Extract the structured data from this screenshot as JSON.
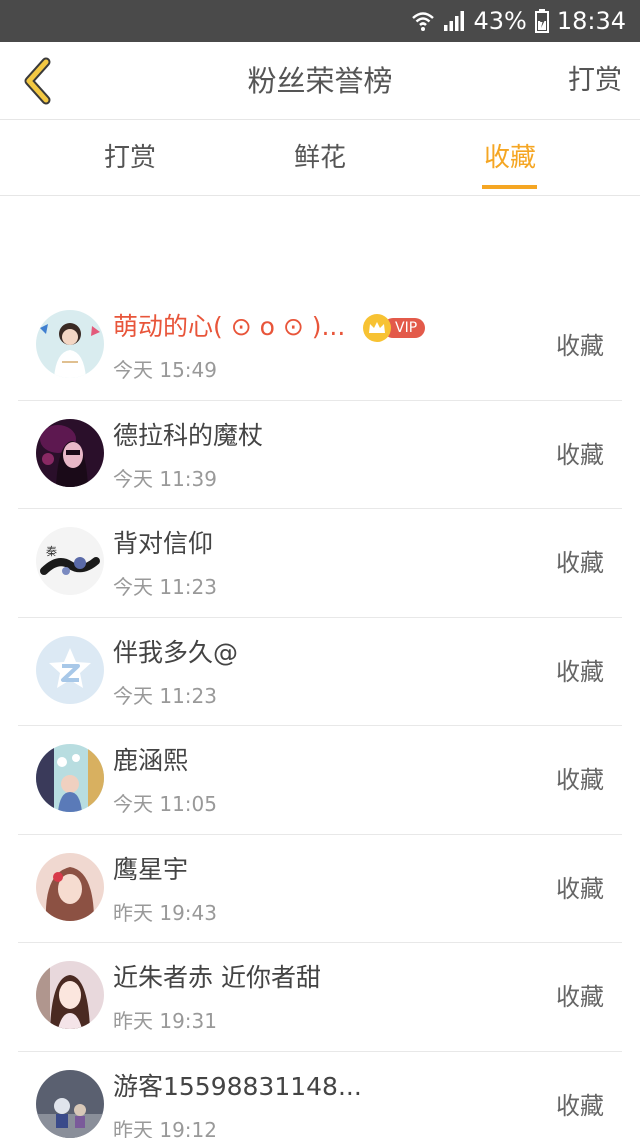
{
  "status_bar": {
    "battery": "43%",
    "time": "18:34",
    "icons": [
      "wifi-icon",
      "signal-icon",
      "battery-icon"
    ]
  },
  "nav": {
    "title": "粉丝荣誉榜",
    "right": "打赏",
    "back_icon": "chevron-left-icon"
  },
  "tabs": [
    {
      "label": "打赏",
      "active": false
    },
    {
      "label": "鲜花",
      "active": false
    },
    {
      "label": "收藏",
      "active": true
    }
  ],
  "colors": {
    "accent": "#f5a623",
    "highlight_name": "#e8553a",
    "vip": "#e35a4a"
  },
  "list": [
    {
      "name": "萌动的心( ⊙ o ⊙ )...",
      "time": "今天 15:49",
      "action": "收藏",
      "vip": "VIP",
      "highlight": true
    },
    {
      "name": "德拉科的魔杖",
      "time": "今天 11:39",
      "action": "收藏"
    },
    {
      "name": "背对信仰",
      "time": "今天 11:23",
      "action": "收藏"
    },
    {
      "name": "伴我多久@",
      "time": "今天 11:23",
      "action": "收藏"
    },
    {
      "name": "鹿涵熙",
      "time": "今天 11:05",
      "action": "收藏"
    },
    {
      "name": "鹰星宇",
      "time": "昨天 19:43",
      "action": "收藏"
    },
    {
      "name": "近朱者赤 近你者甜",
      "time": "昨天 19:31",
      "action": "收藏"
    },
    {
      "name": "游客15598831148...",
      "time": "昨天 19:12",
      "action": "收藏"
    }
  ]
}
